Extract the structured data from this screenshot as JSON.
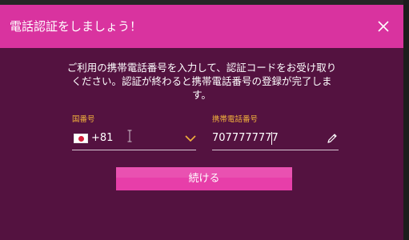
{
  "dialog": {
    "title": "電話認証をしましょう！",
    "instructions": "ご利用の携帯電話番号を入力して、認証コードをお受け取りください。認証が終わると携帯電話番号の登録が完了します。",
    "country_field": {
      "label": "国番号",
      "value": "+81",
      "flag": "japan-flag-icon"
    },
    "phone_field": {
      "label": "携帯電話番号",
      "value": "7077777777"
    },
    "continue_label": "続ける",
    "close_icon": "close-icon"
  },
  "colors": {
    "header": "#d9339f",
    "body": "#541240",
    "button": "#e73ea9",
    "label_accent": "#f2b13c"
  }
}
